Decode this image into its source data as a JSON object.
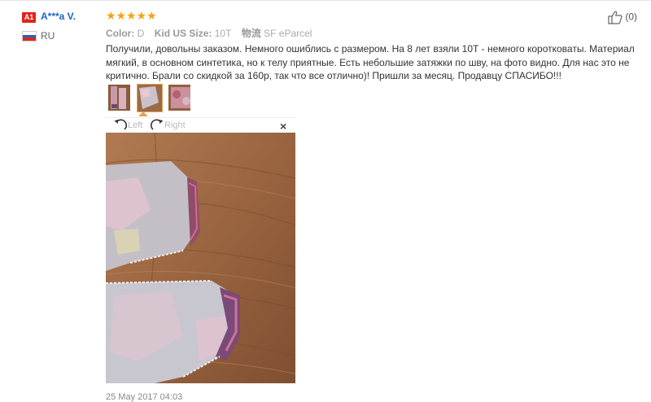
{
  "reviewer": {
    "level_badge": "A1",
    "name": "A***a V.",
    "country": "RU"
  },
  "rating": {
    "stars": 5,
    "max": 5,
    "color": "#f7a215"
  },
  "helpful": {
    "count_label": "(0)"
  },
  "attributes": [
    {
      "key": "Color:",
      "value": "D"
    },
    {
      "key": "Kid US Size:",
      "value": "10T"
    },
    {
      "key": "物流",
      "value": "SF eParcel"
    }
  ],
  "review_text": "Получили, довольны заказом. Немного ошиблись с размером. На 8 лет взяли 10Т - немного коротковаты. Материал мягкий, в основном синтетика, но к телу приятные. Есть небольшие затяжки по шву, на фото видно. Для нас это не критично. Брали со скидкой за 160р, так что все отлично)! Пришли за месяц. Продавцу СПАСИБО!!!",
  "photos": {
    "count": 3,
    "selected_index": 1
  },
  "viewer": {
    "left_label": "Left",
    "right_label": "Right",
    "close_label": "×"
  },
  "date": "25 May 2017 04:03",
  "colors": {
    "link_blue": "#1a63c6",
    "badge_red": "#e2231a",
    "thumb_border": "#e6a050"
  }
}
